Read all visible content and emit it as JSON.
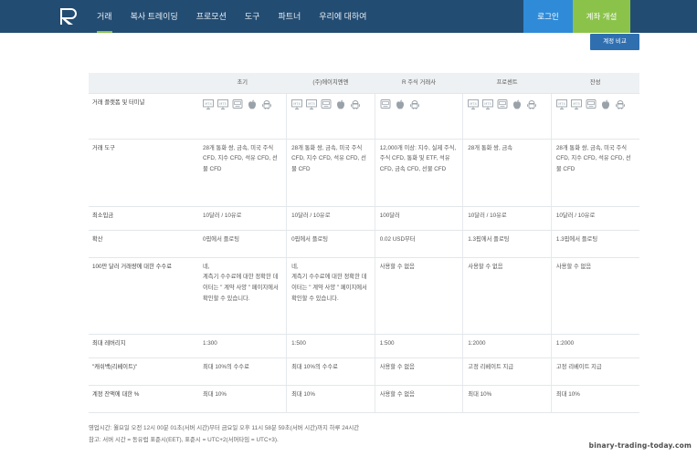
{
  "brand": {
    "logo_text": "R",
    "colors": {
      "header_bg": "#234c72",
      "accent_green": "#8bc34a",
      "login_blue": "#2f8bd8",
      "compare_blue": "#2f6fb0"
    }
  },
  "nav": {
    "items": [
      "거래",
      "복사 트레이딩",
      "프로모션",
      "도구",
      "파트너",
      "우리에 대하여"
    ],
    "active_index": 0
  },
  "header": {
    "login_label": "로그인",
    "signup_label": "계좌 개설"
  },
  "compare_label": "계정 비교",
  "table": {
    "columns": [
      "초기",
      "(주)에이치엔엔",
      "R 주식 거래사",
      "프로센트",
      "잔성"
    ],
    "rows": [
      {
        "label": "거래 플랫폼 및 터미널",
        "type": "icons",
        "cells": [
          [
            "mt4-icon",
            "mt5-icon",
            "desktop-icon",
            "apple-icon",
            "android-icon"
          ],
          [
            "mt4-icon",
            "mt5-icon",
            "desktop-icon",
            "apple-icon",
            "android-icon"
          ],
          [
            "desktop-icon",
            "apple-icon",
            "android-icon"
          ],
          [
            "mt4-icon",
            "mt5-icon",
            "desktop-icon",
            "apple-icon",
            "android-icon"
          ],
          [
            "mt4-icon",
            "mt5-icon",
            "desktop-icon",
            "apple-icon",
            "android-icon"
          ]
        ]
      },
      {
        "label": "거래 도구",
        "type": "text",
        "cells": [
          "28개 통화 쌍, 금속, 미국 주식 CFD, 지수 CFD, 석유 CFD, 선물 CFD",
          "28개 통화 쌍, 금속, 미국 주식 CFD, 지수 CFD, 석유 CFD, 선물 CFD",
          "12,000개 이상: 지수, 실제 주식, 주식 CFD, 통화 및 ETF, 석유 CFD, 금속 CFD, 선물 CFD",
          "28개 통화 쌍, 금속",
          "28개 통화 쌍, 금속, 미국 주식 CFD, 지수 CFD, 석유 CFD, 선물 CFD"
        ]
      },
      {
        "label": "최소입금",
        "type": "text",
        "cells": [
          "10달러 / 10유로",
          "10달러 / 10유로",
          "100달러",
          "10달러 / 10유로",
          "10달러 / 10유로"
        ]
      },
      {
        "label": "확산",
        "type": "text",
        "cells": [
          "0핍에서 플로팅",
          "0핍에서 플로팅",
          "0.02 USD부터",
          "1.3핍에서 플로팅",
          "1.3핍에서 플로팅"
        ]
      },
      {
        "label": "100만 달러 거래량에 대한 수수료",
        "type": "text",
        "cells": [
          "네,\n계측기 수수료에 대한 정확한 데이터는 \" 계약 사양 \" 페이지에서 확인할 수 있습니다.",
          "네,\n계측기 수수료에 대한 정확한 데이터는 \" 계약 사양 \" 페이지에서 확인할 수 있습니다.",
          "사용할 수 없음",
          "사용할 수 없음",
          "사용할 수 없음"
        ]
      },
      {
        "label": "최대 레버리지",
        "type": "text",
        "cells": [
          "1:300",
          "1:500",
          "1:500",
          "1:2000",
          "1:2000"
        ]
      },
      {
        "label": "\"캐쉬백(리베이트)\"",
        "type": "text",
        "cells": [
          "최대 10%의 수수료",
          "최대 10%의 수수료",
          "사용할 수 없음",
          "고정 리베이트 지급",
          "고정 리베이트 지급"
        ]
      },
      {
        "label": "계정 잔액에 대한 %",
        "type": "text",
        "cells": [
          "최대 10%",
          "최대 10%",
          "사용할 수 없음",
          "최대 10%",
          "최대 10%"
        ]
      }
    ]
  },
  "footnotes": {
    "line1": "영업시간: 월요일 오전 12시 00분 01초(서버 시간)부터 금요일 오후 11시 58분 59초(서버 시간)까지 하루 24시간",
    "line2": "참고: 서버 시간 = 동유럽 표준시(EET), 표준시 = UTC+2(서머타임 = UTC+3)."
  },
  "watermark": "binary-trading-today.com"
}
